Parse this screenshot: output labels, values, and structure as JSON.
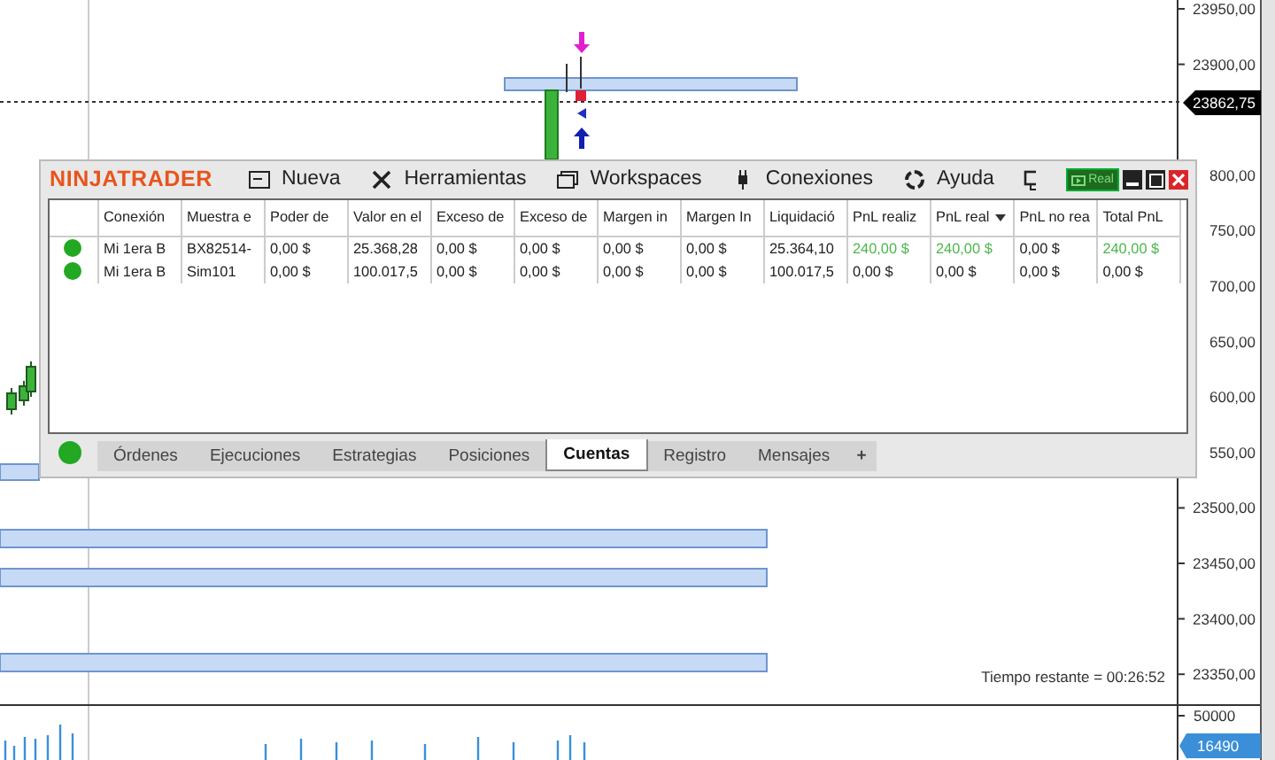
{
  "chart": {
    "price_axis": [
      "23950,00",
      "23900,00",
      "800,00",
      "750,00",
      "700,00",
      "650,00",
      "600,00",
      "550,00",
      "23500,00",
      "23450,00",
      "23400,00",
      "23350,00"
    ],
    "last_price": "23862,75",
    "timer": "Tiempo restante = 00:26:52",
    "volume_axis": "50000",
    "last_volume": "16490"
  },
  "window": {
    "logo": "NINJATRADER",
    "menu": [
      {
        "label": "Nueva",
        "kind": "new"
      },
      {
        "label": "Herramientas",
        "kind": "tools"
      },
      {
        "label": "Workspaces",
        "kind": "workspaces"
      },
      {
        "label": "Conexiones",
        "kind": "connections"
      },
      {
        "label": "Ayuda",
        "kind": "help"
      }
    ],
    "mode_badge": "Real",
    "table": {
      "columns": [
        {
          "label": "Conexión",
          "sorted": false
        },
        {
          "label": "Muestra e",
          "sorted": false
        },
        {
          "label": "Poder de",
          "sorted": false
        },
        {
          "label": "Valor en el",
          "sorted": false
        },
        {
          "label": "Exceso de",
          "sorted": false
        },
        {
          "label": "Exceso de",
          "sorted": false
        },
        {
          "label": "Margen in",
          "sorted": false
        },
        {
          "label": "Margen In",
          "sorted": false
        },
        {
          "label": "Liquidació",
          "sorted": false
        },
        {
          "label": "PnL realiz",
          "sorted": false
        },
        {
          "label": "PnL real",
          "sorted": true
        },
        {
          "label": "PnL no rea",
          "sorted": false
        },
        {
          "label": "Total PnL",
          "sorted": false
        }
      ],
      "rows": [
        {
          "color": "#22a822",
          "cells": [
            {
              "text": "Mi 1era B"
            },
            {
              "text": "BX82514-"
            },
            {
              "text": "0,00 $"
            },
            {
              "text": "25.368,28"
            },
            {
              "text": "0,00 $"
            },
            {
              "text": "0,00 $"
            },
            {
              "text": "0,00 $"
            },
            {
              "text": "0,00 $"
            },
            {
              "text": "25.364,10"
            },
            {
              "text": "240,00 $",
              "gain": true
            },
            {
              "text": "240,00 $",
              "gain": true
            },
            {
              "text": "0,00 $"
            },
            {
              "text": "240,00 $",
              "gain": true
            }
          ]
        },
        {
          "color": "#22a822",
          "cells": [
            {
              "text": "Mi 1era B"
            },
            {
              "text": "Sim101"
            },
            {
              "text": "0,00 $"
            },
            {
              "text": "100.017,5"
            },
            {
              "text": "0,00 $"
            },
            {
              "text": "0,00 $"
            },
            {
              "text": "0,00 $"
            },
            {
              "text": "0,00 $"
            },
            {
              "text": "100.017,5"
            },
            {
              "text": "0,00 $"
            },
            {
              "text": "0,00 $"
            },
            {
              "text": "0,00 $"
            },
            {
              "text": "0,00 $"
            }
          ]
        }
      ]
    },
    "status_dot": {
      "color": "#22a822"
    },
    "tabs": [
      {
        "label": "Órdenes",
        "selected": false
      },
      {
        "label": "Ejecuciones",
        "selected": false
      },
      {
        "label": "Estrategias",
        "selected": false
      },
      {
        "label": "Posiciones",
        "selected": false
      },
      {
        "label": "Cuentas",
        "selected": true
      },
      {
        "label": "Registro",
        "selected": false
      },
      {
        "label": "Mensajes",
        "selected": false
      }
    ],
    "add_tab": "+"
  }
}
